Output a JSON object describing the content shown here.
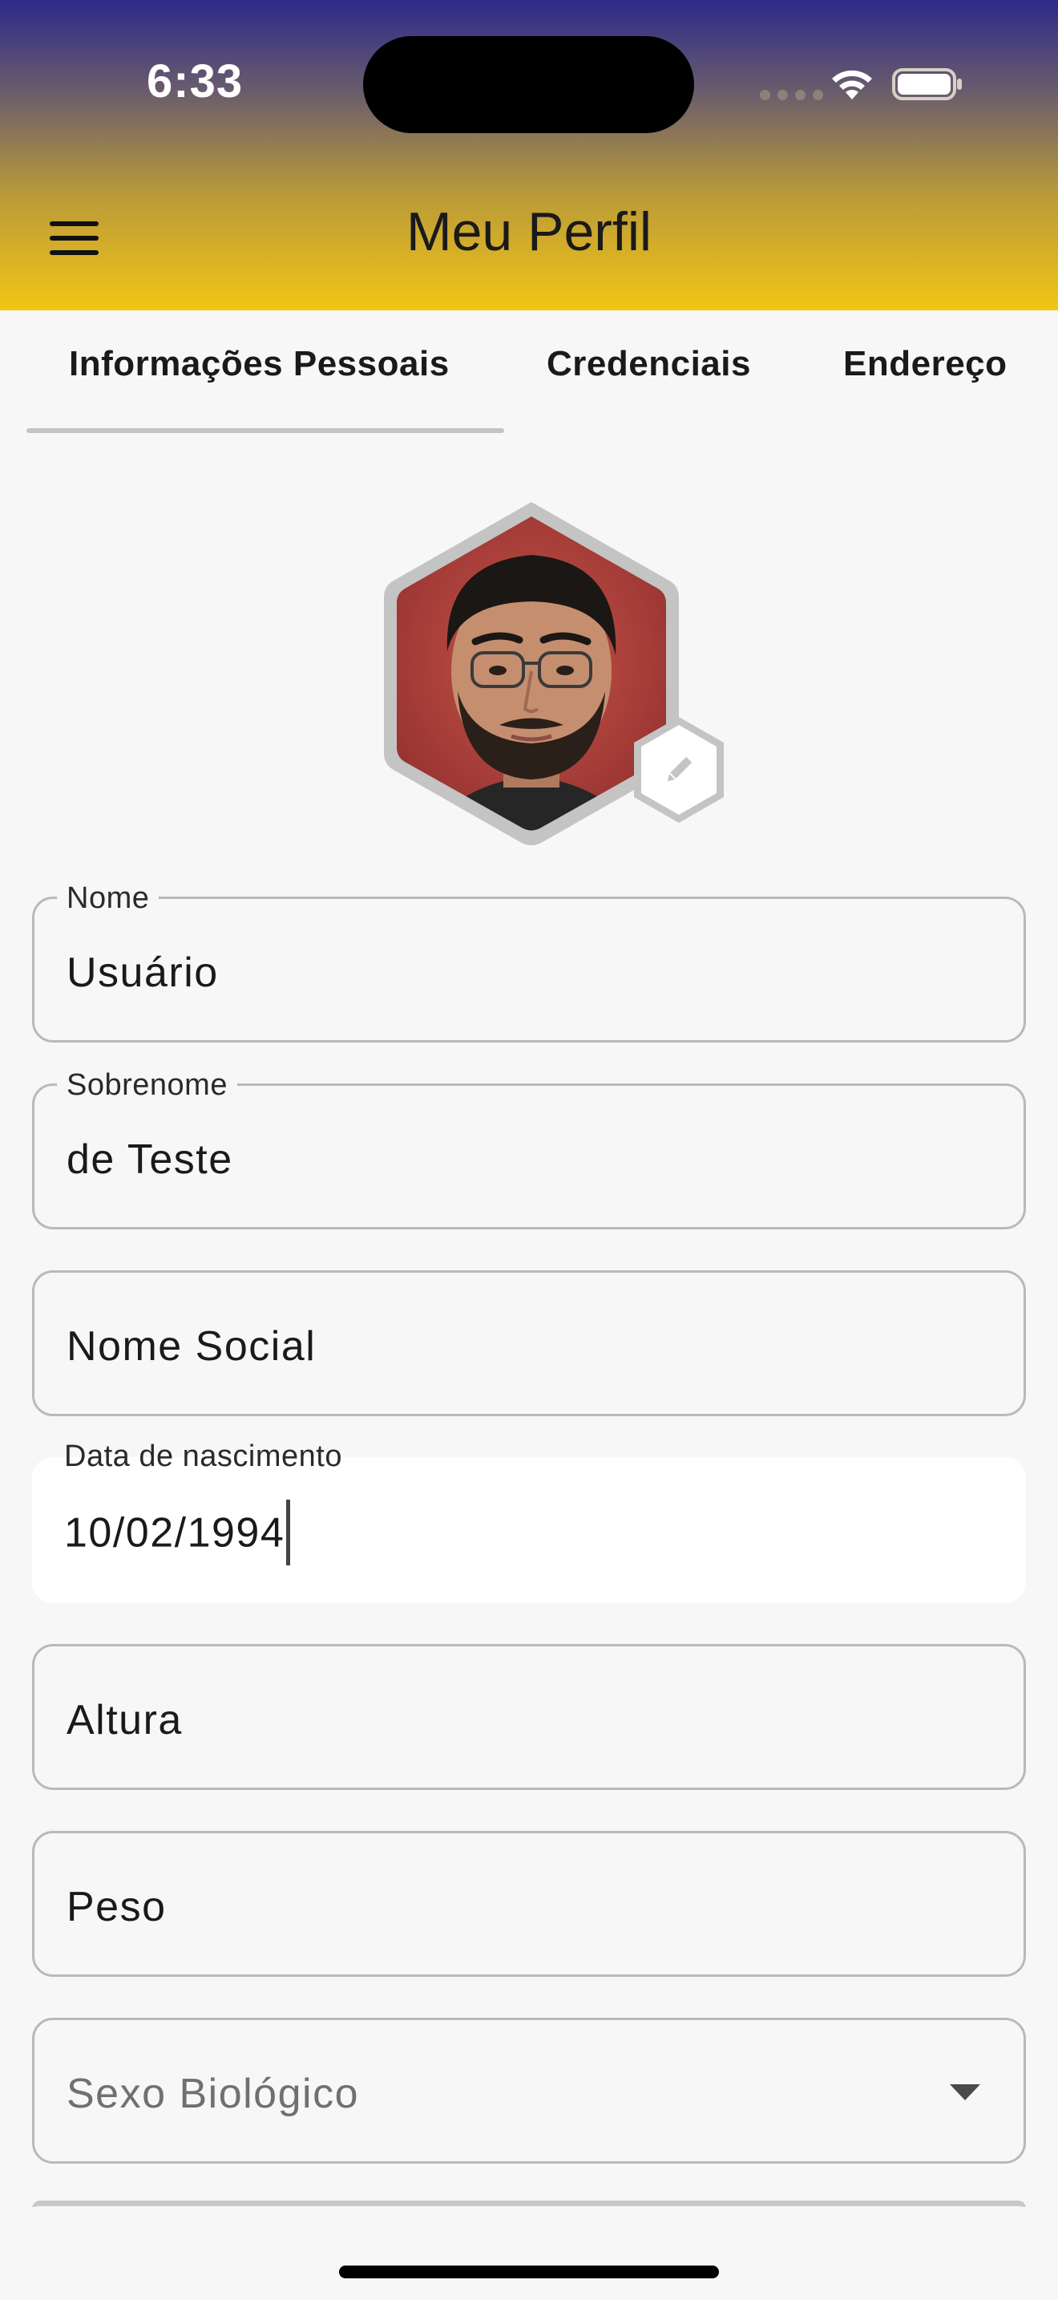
{
  "status_bar": {
    "time": "6:33"
  },
  "header": {
    "title": "Meu Perfil",
    "menu_icon": "hamburger-menu-icon"
  },
  "tabs": [
    {
      "label": "Informações Pessoais",
      "active": true
    },
    {
      "label": "Credenciais",
      "active": false
    },
    {
      "label": "Endereço",
      "active": false
    }
  ],
  "avatar": {
    "edit_icon": "pencil-icon"
  },
  "form": {
    "nome": {
      "label": "Nome",
      "value": "Usuário"
    },
    "sobrenome": {
      "label": "Sobrenome",
      "value": "de Teste"
    },
    "nome_social": {
      "placeholder": "Nome Social"
    },
    "data_nascimento": {
      "label": "Data de nascimento",
      "value": "10/02/1994"
    },
    "altura": {
      "placeholder": "Altura"
    },
    "peso": {
      "placeholder": "Peso"
    },
    "sexo_biologico": {
      "placeholder": "Sexo Biológico",
      "icon": "dropdown-arrow-icon"
    }
  },
  "colors": {
    "header_gradient_top": "#2d2a8a",
    "header_gradient_bottom": "#f2c515",
    "background": "#f7f7f7",
    "field_border": "#b9b9b9"
  }
}
